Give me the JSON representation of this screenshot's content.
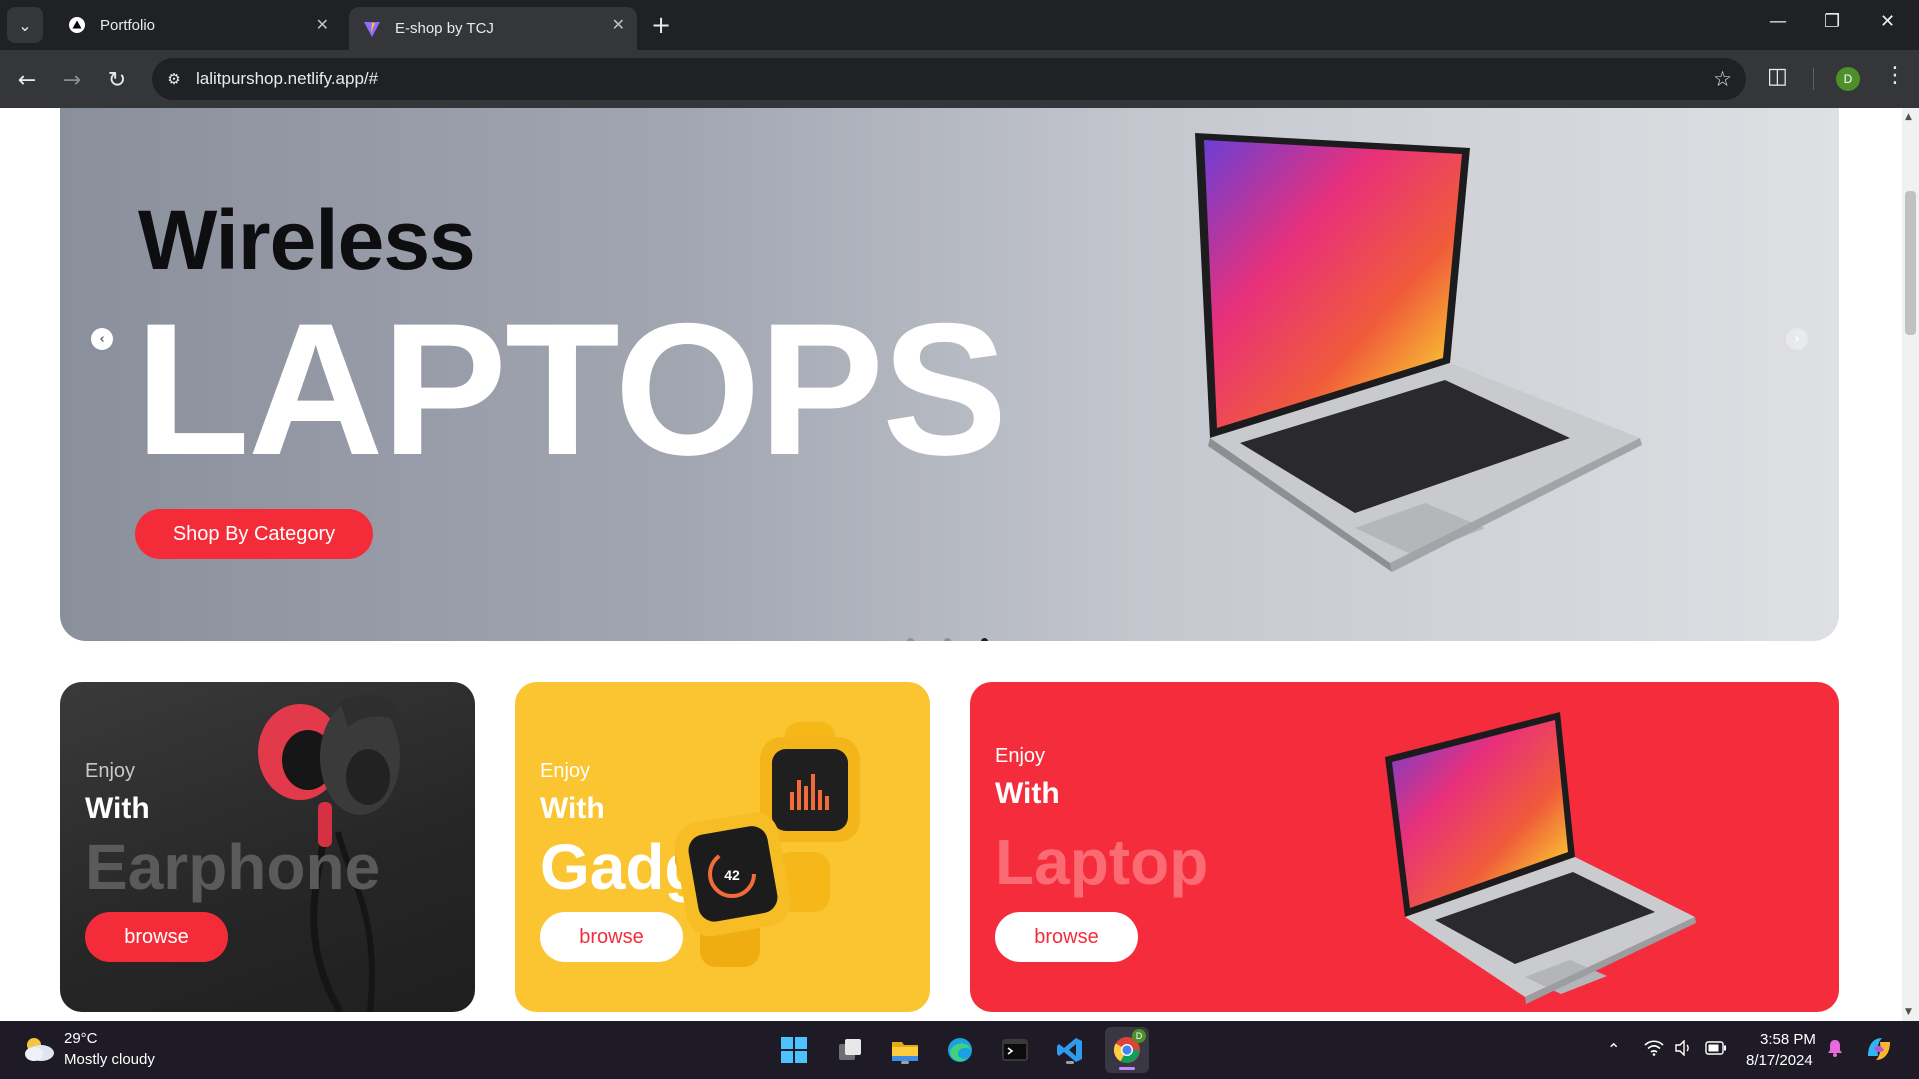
{
  "browser": {
    "tabs": [
      {
        "title": "Portfolio",
        "active": false
      },
      {
        "title": "E-shop by TCJ",
        "active": true
      }
    ],
    "url": "lalitpurshop.netlify.app/#",
    "profile_initial": "D",
    "icons": [
      "tab-search-icon",
      "close-icon",
      "new-tab-icon",
      "minimize-icon",
      "restore-icon",
      "back-icon",
      "forward-icon",
      "reload-icon",
      "site-info-icon",
      "bookmark-star-icon",
      "extensions-icon",
      "menu-icon"
    ]
  },
  "hero": {
    "line1": "Wireless",
    "line2": "LAPTOPS",
    "cta": "Shop By Category",
    "slides_total": 3,
    "active_slide": 3,
    "colors": {
      "cta": "#f42c39",
      "gradient_start": "#8a8f9c",
      "gradient_end": "#dfe0e4"
    }
  },
  "categories": [
    {
      "enjoy": "Enjoy",
      "with": "With",
      "name": "Earphone",
      "button": "browse",
      "bg": "#2c2c2c"
    },
    {
      "enjoy": "Enjoy",
      "with": "With",
      "name": "Gadget",
      "button": "browse",
      "bg": "#fbc531"
    },
    {
      "enjoy": "Enjoy",
      "with": "With",
      "name": "Laptop",
      "button": "browse",
      "bg": "#f42c3b"
    }
  ],
  "gadget_watch_reading": "42",
  "taskbar": {
    "weather_temp": "29°C",
    "weather_desc": "Mostly cloudy",
    "apps": [
      "windows-start-icon",
      "task-view-icon",
      "file-explorer-icon",
      "edge-icon",
      "terminal-icon",
      "vscode-icon",
      "chrome-icon"
    ],
    "chrome_badge": "D",
    "time": "3:58 PM",
    "date": "8/17/2024"
  }
}
